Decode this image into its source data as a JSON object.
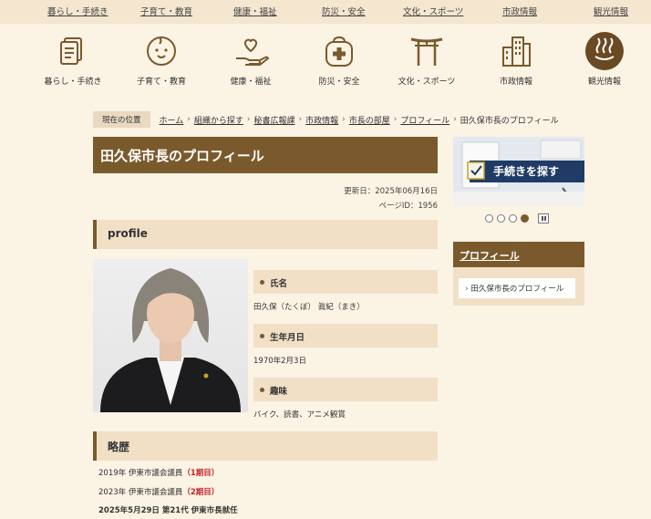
{
  "topnav": [
    "暮らし・手続き",
    "子育て・教育",
    "健康・福祉",
    "防災・安全",
    "文化・スポーツ",
    "市政情報",
    "観光情報"
  ],
  "iconnav": [
    {
      "label": "暮らし・手続き",
      "icon": "document-icon"
    },
    {
      "label": "子育て・教育",
      "icon": "baby-face-icon"
    },
    {
      "label": "健康・福祉",
      "icon": "heart-hand-icon"
    },
    {
      "label": "防災・安全",
      "icon": "emergency-bag-icon"
    },
    {
      "label": "文化・スポーツ",
      "icon": "torii-gate-icon"
    },
    {
      "label": "市政情報",
      "icon": "city-building-icon"
    },
    {
      "label": "観光情報",
      "icon": "hot-spring-icon"
    }
  ],
  "breadcrumb": {
    "badge": "現在の位置",
    "items": [
      "ホーム",
      "組織から探す",
      "秘書広報課",
      "市政情報",
      "市長の部屋",
      "プロフィール"
    ],
    "current": "田久保市長のプロフィール"
  },
  "page": {
    "title": "田久保市長のプロフィール",
    "updated": "更新日：2025年06月16日",
    "page_id": "ページID：1956"
  },
  "profile": {
    "section_title": "profile",
    "fields": [
      {
        "label": "氏名",
        "value": "田久保（たくぼ） 眞紀（まき）"
      },
      {
        "label": "生年月日",
        "value": "1970年2月3日"
      },
      {
        "label": "趣味",
        "value": "バイク、読書、アニメ観賞"
      }
    ]
  },
  "history": {
    "section_title": "略歴",
    "items": [
      {
        "text": "2019年 伊東市議会議員",
        "tag": "（1期目）"
      },
      {
        "text": "2023年 伊東市議会議員",
        "tag": "（2期目）"
      },
      {
        "text": "2025年5月29日 第21代 伊東市長就任",
        "tag": ""
      }
    ]
  },
  "sidebar": {
    "banner_text": "手続きを探す",
    "carousel_active": 4,
    "box_title": "プロフィール",
    "link": "田久保市長のプロフィール"
  },
  "colors": {
    "accent": "#7a5a2c",
    "background": "#fbf3e4",
    "highlight": "#c0262c"
  }
}
